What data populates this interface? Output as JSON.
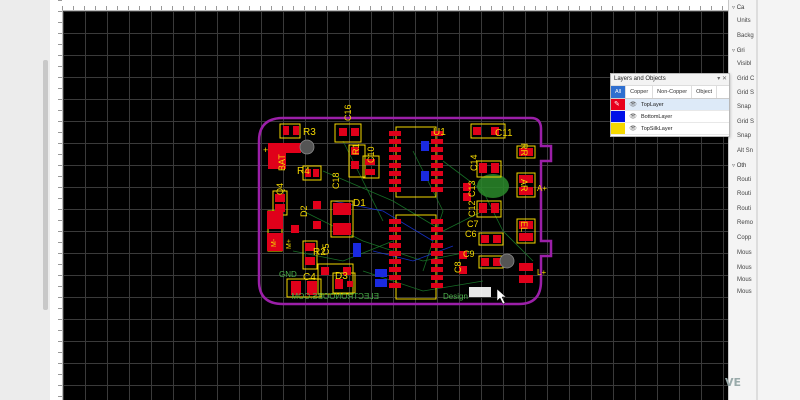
{
  "board": {
    "outline_color": "#9b1fa8",
    "copper_color": "#e0001a",
    "silk_color": "#f5d800",
    "designators": [
      "R3",
      "C16",
      "U1",
      "C11",
      "RR",
      "BAT",
      "R1",
      "C10",
      "C14",
      "C13",
      "R4",
      "C18",
      "AR",
      "Q4",
      "D1",
      "C12",
      "D2",
      "C7",
      "C6",
      "R2",
      "C5",
      "C9",
      "EL",
      "C4",
      "D3",
      "C8"
    ],
    "silk_text": [
      "ELECTRONOOBS.COM",
      "Design",
      "GND",
      "M-",
      "M+"
    ],
    "pad_labels": [
      "+",
      "L+",
      "A+"
    ]
  },
  "layers_panel": {
    "title": "Layers and Objects",
    "controls": "▾ ✕",
    "tabs": [
      "All",
      "Copper",
      "Non-Copper",
      "Object"
    ],
    "active_tab": "All",
    "layers": [
      {
        "name": "TopLayer",
        "color": "#e8001c",
        "icon": "pencil-icon",
        "eye": "👁",
        "selected": true
      },
      {
        "name": "BottomLayer",
        "color": "#0010e8",
        "icon": "",
        "eye": "👁",
        "selected": false
      },
      {
        "name": "TopSilkLayer",
        "color": "#f5d800",
        "icon": "",
        "eye": "👁",
        "selected": false
      }
    ]
  },
  "right_pane": {
    "sections": [
      "Ca",
      "Gri",
      "Oth"
    ],
    "rows_canvas": [
      "Units",
      "Backg"
    ],
    "rows_grid": [
      "Visibl",
      "Grid C",
      "Grid S",
      "Snap",
      "Grid S",
      "Snap",
      "Alt Sn"
    ],
    "rows_other": [
      "Routi",
      "Routi",
      "Routi",
      "Remo",
      "Copp",
      "Mous",
      "Mous",
      "Mous",
      "Mous"
    ]
  },
  "watermark": "VE"
}
